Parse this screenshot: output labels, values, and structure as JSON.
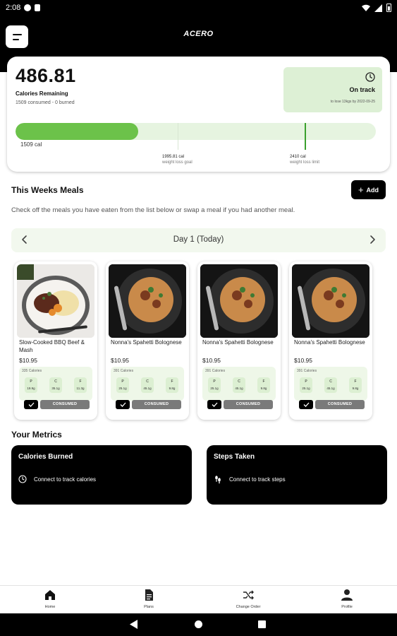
{
  "status_bar": {
    "time": "2:08"
  },
  "header": {
    "logo": "ACERO"
  },
  "calories": {
    "remaining": "486.81",
    "remaining_label": "Calories Remaining",
    "summary": "1509 consumed - 0 burned",
    "status": "On track",
    "status_note": "to lose 13kgs by 2022-09-25",
    "progress_label": "1509 cal",
    "progress_fraction": 0.34,
    "goal_fraction": 0.45,
    "limit_fraction": 0.805,
    "goal_value": "1995.81 cal",
    "goal_caption": "weight loss goal",
    "limit_value": "2410 cal",
    "limit_caption": "weight loss limit",
    "accent_color": "#6cc24a"
  },
  "meals": {
    "section_title": "This Weeks Meals",
    "add_label": "Add",
    "description": "Check off the meals you have eaten from the list below or swap a meal if you had another meal.",
    "day_label": "Day 1 (Today)",
    "consumed_label": "CONSUMED",
    "items": [
      {
        "name": "Slow-Cooked BBQ Beef & Mash",
        "price": "$10.95",
        "calories": "335 Calories",
        "protein_label": "P",
        "protein": "19.9g",
        "carb_label": "C",
        "carbs": "35.1g",
        "fat_label": "F",
        "fat": "11.3g"
      },
      {
        "name": "Nonna's Spahetti Bolognese",
        "price": "$10.95",
        "calories": "391 Calories",
        "protein_label": "P",
        "protein": "25.1g",
        "carb_label": "C",
        "carbs": "45.1g",
        "fat_label": "F",
        "fat": "9.8g"
      },
      {
        "name": "Nonna's Spahetti Bolognese",
        "price": "$10.95",
        "calories": "391 Calories",
        "protein_label": "P",
        "protein": "25.1g",
        "carb_label": "C",
        "carbs": "45.1g",
        "fat_label": "F",
        "fat": "9.8g"
      },
      {
        "name": "Nonna's Spahetti Bolognese",
        "price": "$10.95",
        "calories": "391 Calories",
        "protein_label": "P",
        "protein": "25.1g",
        "carb_label": "C",
        "carbs": "45.1g",
        "fat_label": "F",
        "fat": "9.8g"
      }
    ]
  },
  "metrics": {
    "section_title": "Your Metrics",
    "calories_burned": {
      "title": "Calories Burned",
      "action": "Connect to track calories"
    },
    "steps_taken": {
      "title": "Steps Taken",
      "action": "Connect to track steps"
    }
  },
  "nav": {
    "home": "Home",
    "plans": "Plans",
    "change_order": "Change Order",
    "profile": "Profile"
  }
}
